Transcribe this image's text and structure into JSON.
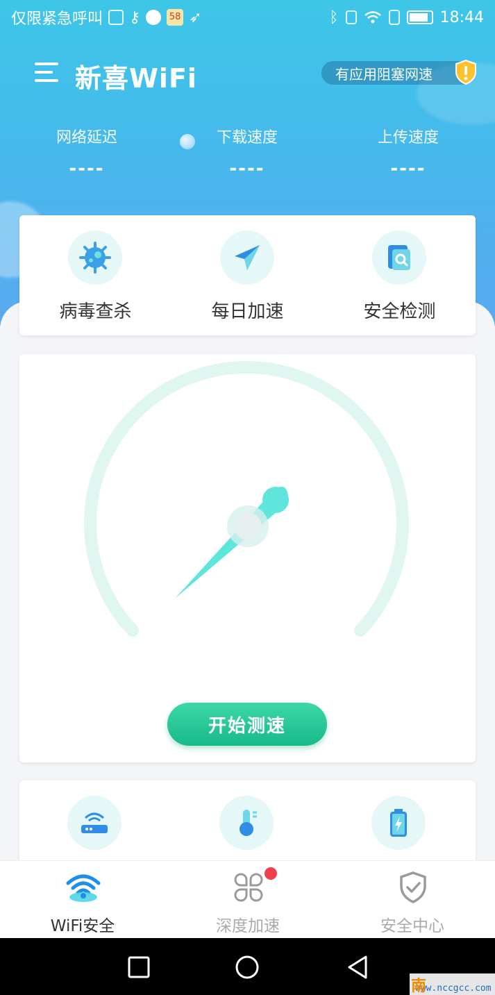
{
  "status_bar": {
    "carrier": "仅限紧急呼叫",
    "time": "18:44",
    "notif_badge": "58"
  },
  "header": {
    "title": "新喜WiFi",
    "alert_text": "有应用阻塞网速"
  },
  "metrics": [
    {
      "label": "网络延迟",
      "value": "----"
    },
    {
      "label": "下载速度",
      "value": "----"
    },
    {
      "label": "上传速度",
      "value": "----"
    }
  ],
  "tools": [
    {
      "label": "病毒查杀",
      "icon": "virus-icon"
    },
    {
      "label": "每日加速",
      "icon": "paper-plane-icon"
    },
    {
      "label": "安全检测",
      "icon": "document-search-icon"
    }
  ],
  "speed_test": {
    "button_label": "开始测速",
    "gauge_color": "#dff7f0",
    "needle_color": "#5ee6dc"
  },
  "tools2": [
    {
      "icon": "router-icon"
    },
    {
      "icon": "thermometer-icon"
    },
    {
      "icon": "battery-icon"
    }
  ],
  "tabs": [
    {
      "label": "WiFi安全",
      "icon": "wifi-icon",
      "active": true
    },
    {
      "label": "深度加速",
      "icon": "apps-grid-icon",
      "active": false,
      "badge": true
    },
    {
      "label": "安全中心",
      "icon": "shield-check-icon",
      "active": false
    }
  ],
  "watermark": {
    "text": "www.nccgcc.com",
    "mark": "南"
  },
  "colors": {
    "accent": "#17b98a",
    "hero_top": "#3dc6e8",
    "hero_bottom": "#5aa9f0"
  }
}
